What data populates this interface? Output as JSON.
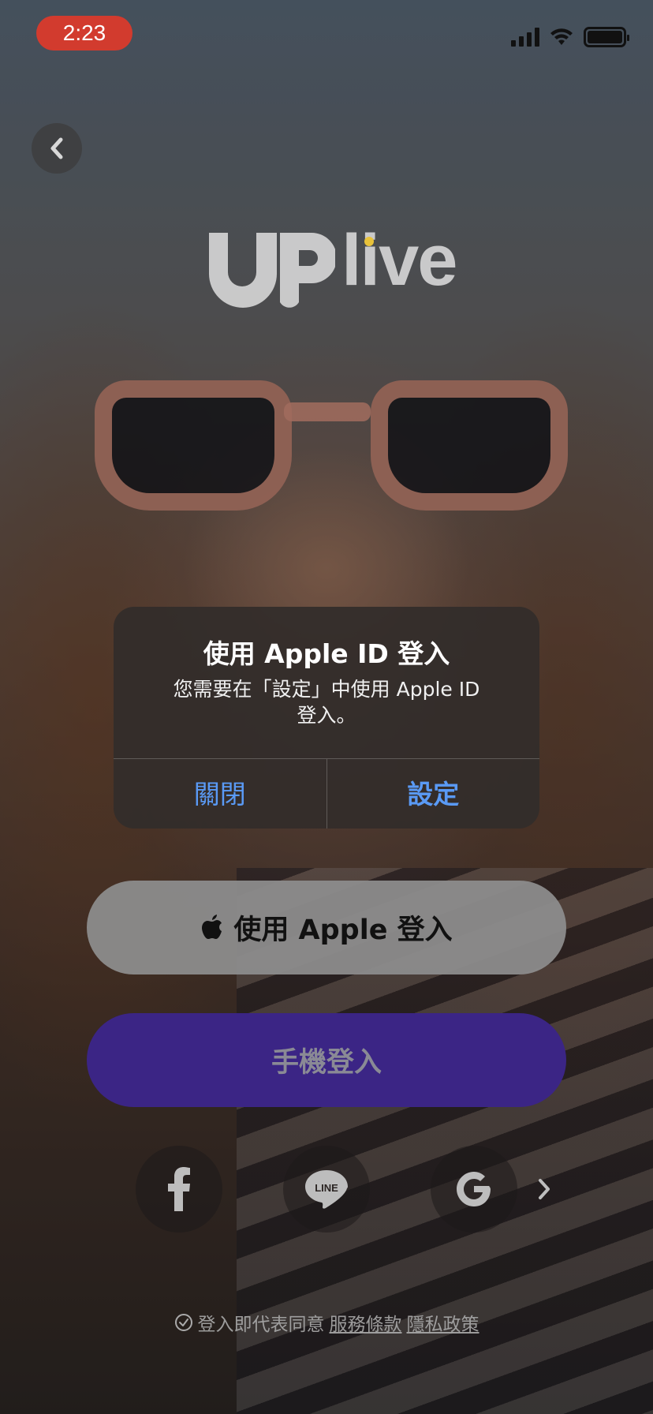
{
  "status_bar": {
    "time": "2:23"
  },
  "logo": {
    "text": "live"
  },
  "alert": {
    "title": "使用 Apple ID 登入",
    "message": "您需要在「設定」中使用 Apple ID 登入。",
    "close_label": "關閉",
    "settings_label": "設定"
  },
  "buttons": {
    "apple_signin_label": "使用 Apple 登入",
    "phone_signin_label": "手機登入"
  },
  "social": {
    "icons": [
      "facebook-icon",
      "line-icon",
      "google-icon",
      "chevron-right-icon"
    ]
  },
  "terms": {
    "prefix": "登入即代表同意",
    "terms_link": "服務條款",
    "privacy_link": "隱私政策"
  },
  "colors": {
    "time_pill": "#d23b2e",
    "alert_button": "#5a9af5",
    "phone_button": "#3b2585",
    "apple_button": "#8c8c8c"
  }
}
